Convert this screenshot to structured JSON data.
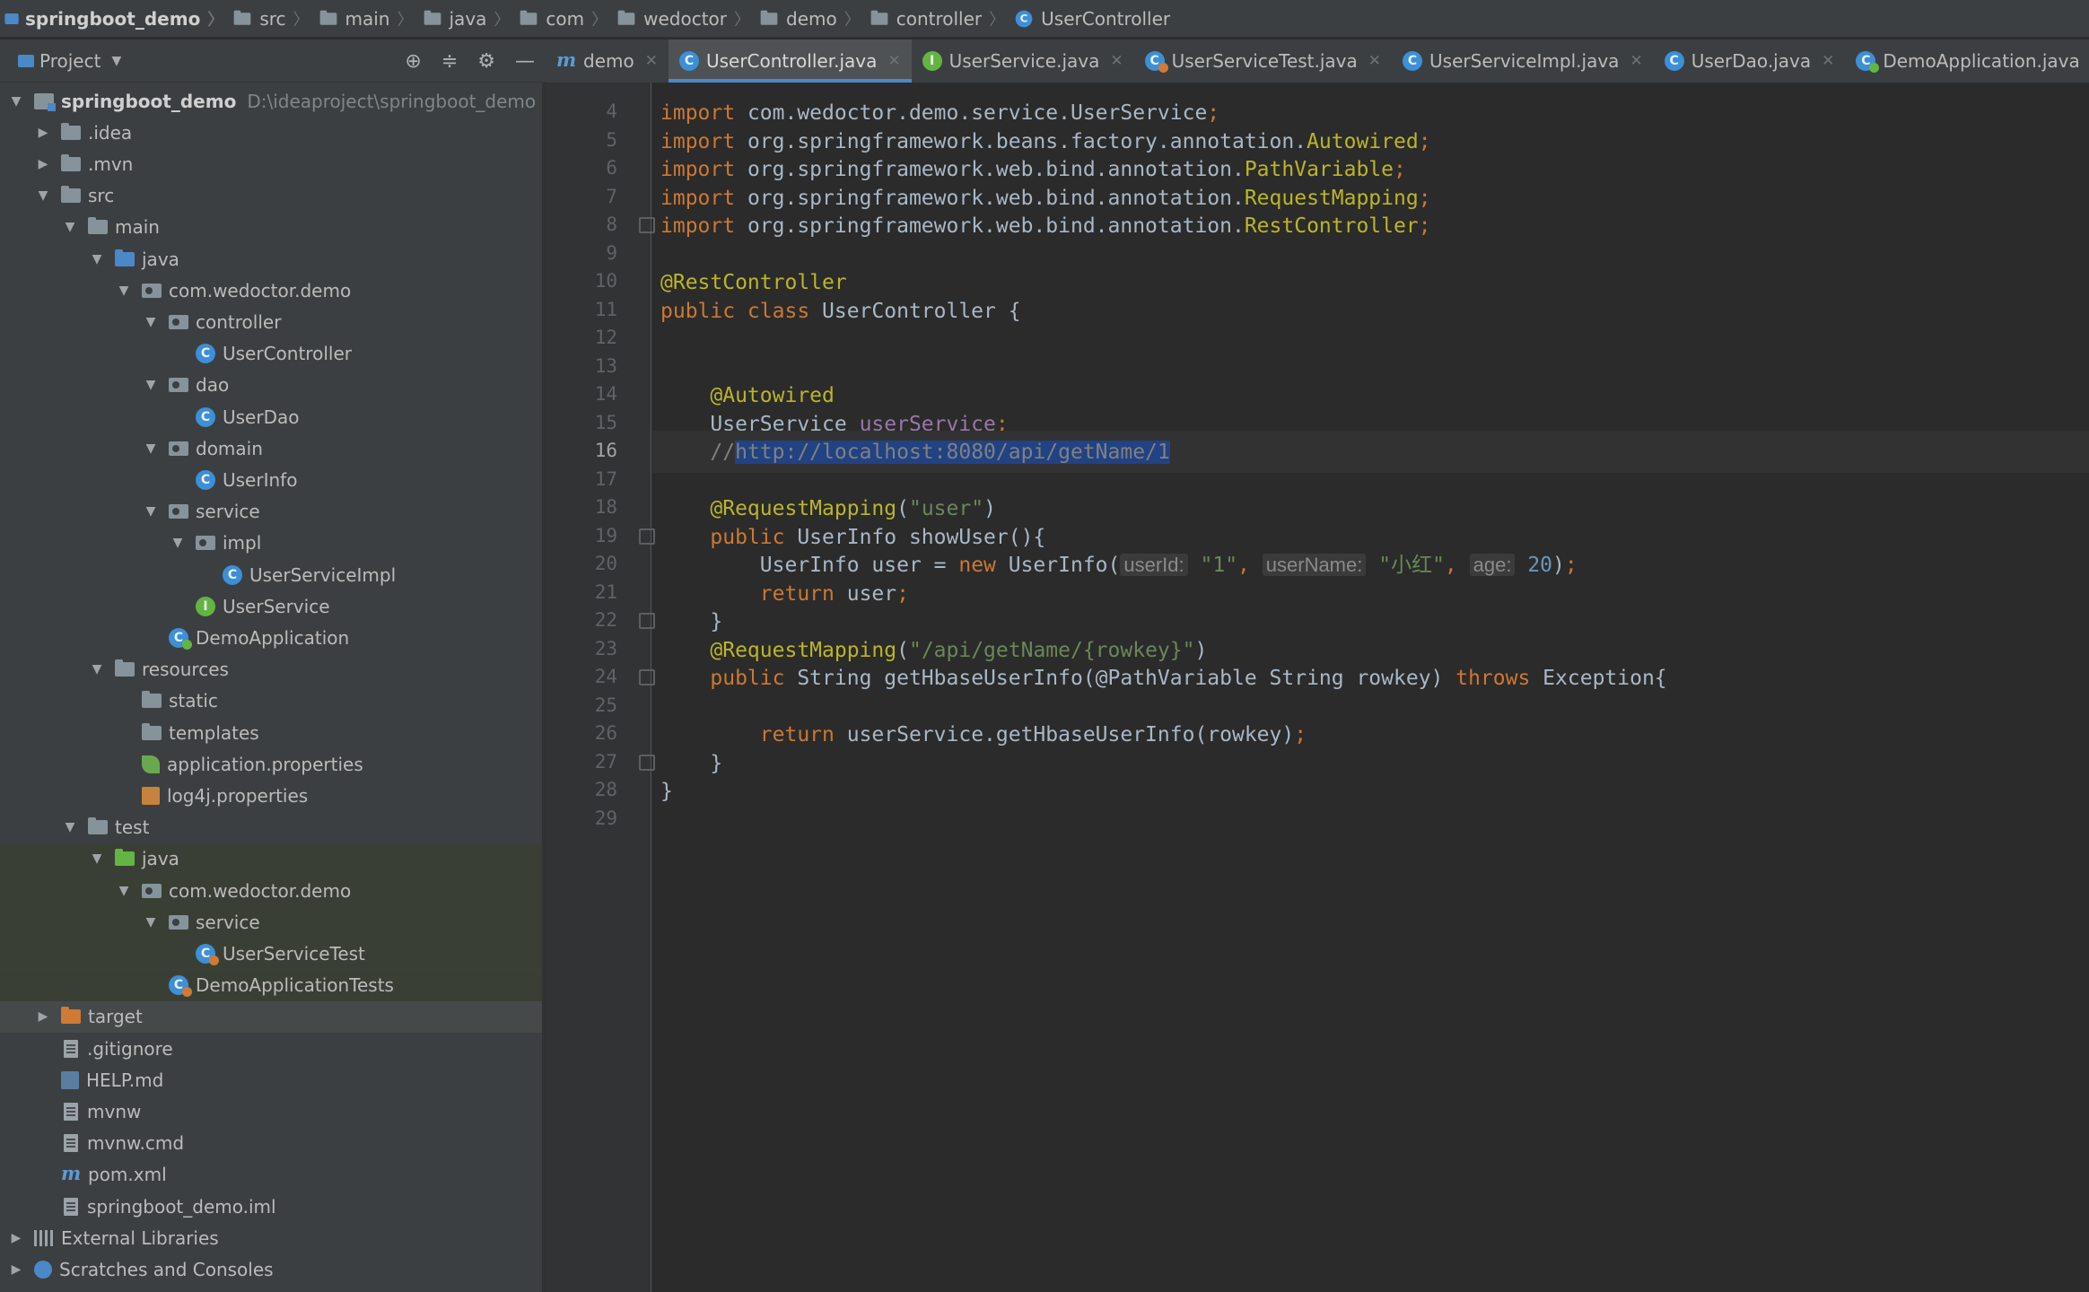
{
  "breadcrumb": [
    "springboot_demo",
    "src",
    "main",
    "java",
    "com",
    "wedoctor",
    "demo",
    "controller",
    "UserController"
  ],
  "project_panel": {
    "title": "Project",
    "toolbar_icons": [
      "locate-icon",
      "collapse-icon",
      "gear-icon",
      "minimize-icon"
    ],
    "tree": [
      {
        "label": "springboot_demo",
        "path": "D:\\ideaproject\\springboot_demo",
        "icon": "module-folder-icon",
        "depth": 0,
        "expanded": true
      },
      {
        "label": ".idea",
        "icon": "folder-icon",
        "depth": 1,
        "expanded": false
      },
      {
        "label": ".mvn",
        "icon": "folder-icon",
        "depth": 1,
        "expanded": false
      },
      {
        "label": "src",
        "icon": "folder-icon",
        "depth": 1,
        "expanded": true
      },
      {
        "label": "main",
        "icon": "folder-icon",
        "depth": 2,
        "expanded": true
      },
      {
        "label": "java",
        "icon": "source-folder-icon",
        "depth": 3,
        "expanded": true
      },
      {
        "label": "com.wedoctor.demo",
        "icon": "package-icon",
        "depth": 4,
        "expanded": true
      },
      {
        "label": "controller",
        "icon": "package-icon",
        "depth": 5,
        "expanded": true
      },
      {
        "label": "UserController",
        "icon": "class-icon",
        "depth": 6
      },
      {
        "label": "dao",
        "icon": "package-icon",
        "depth": 5,
        "expanded": true
      },
      {
        "label": "UserDao",
        "icon": "class-icon",
        "depth": 6
      },
      {
        "label": "domain",
        "icon": "package-icon",
        "depth": 5,
        "expanded": true
      },
      {
        "label": "UserInfo",
        "icon": "class-icon",
        "depth": 6
      },
      {
        "label": "service",
        "icon": "package-icon",
        "depth": 5,
        "expanded": true
      },
      {
        "label": "impl",
        "icon": "package-icon",
        "depth": 6,
        "expanded": true
      },
      {
        "label": "UserServiceImpl",
        "icon": "class-icon",
        "depth": 7
      },
      {
        "label": "UserService",
        "icon": "interface-icon",
        "depth": 6
      },
      {
        "label": "DemoApplication",
        "icon": "spring-app-class-icon",
        "depth": 5
      },
      {
        "label": "resources",
        "icon": "resources-folder-icon",
        "depth": 3,
        "expanded": true
      },
      {
        "label": "static",
        "icon": "folder-icon",
        "depth": 4
      },
      {
        "label": "templates",
        "icon": "folder-icon",
        "depth": 4
      },
      {
        "label": "application.properties",
        "icon": "spring-leaf-icon",
        "depth": 4
      },
      {
        "label": "log4j.properties",
        "icon": "properties-icon",
        "depth": 4
      },
      {
        "label": "test",
        "icon": "folder-icon",
        "depth": 2,
        "expanded": true
      },
      {
        "label": "java",
        "icon": "test-folder-icon",
        "depth": 3,
        "expanded": true,
        "highlight": "test"
      },
      {
        "label": "com.wedoctor.demo",
        "icon": "package-icon",
        "depth": 4,
        "expanded": true,
        "highlight": "test"
      },
      {
        "label": "service",
        "icon": "package-icon",
        "depth": 5,
        "expanded": true,
        "highlight": "test"
      },
      {
        "label": "UserServiceTest",
        "icon": "test-class-icon",
        "depth": 6,
        "highlight": "test"
      },
      {
        "label": "DemoApplicationTests",
        "icon": "test-class-icon",
        "depth": 5,
        "highlight": "test"
      },
      {
        "label": "target",
        "icon": "excluded-folder-icon",
        "depth": 1,
        "expanded": false,
        "highlight": "selected"
      },
      {
        "label": ".gitignore",
        "icon": "file-icon",
        "depth": 1
      },
      {
        "label": "HELP.md",
        "icon": "markdown-icon",
        "depth": 1
      },
      {
        "label": "mvnw",
        "icon": "file-icon",
        "depth": 1
      },
      {
        "label": "mvnw.cmd",
        "icon": "file-icon",
        "depth": 1
      },
      {
        "label": "pom.xml",
        "icon": "maven-icon",
        "depth": 1
      },
      {
        "label": "springboot_demo.iml",
        "icon": "file-icon",
        "depth": 1
      },
      {
        "label": "External Libraries",
        "icon": "libraries-icon",
        "depth": 0,
        "expanded": false
      },
      {
        "label": "Scratches and Consoles",
        "icon": "scratches-icon",
        "depth": 0,
        "expanded": false
      }
    ]
  },
  "tabs": [
    {
      "label": "demo",
      "icon": "maven-icon",
      "active": false
    },
    {
      "label": "UserController.java",
      "icon": "class-icon",
      "active": true
    },
    {
      "label": "UserService.java",
      "icon": "interface-icon",
      "active": false
    },
    {
      "label": "UserServiceTest.java",
      "icon": "test-class-icon",
      "active": false
    },
    {
      "label": "UserServiceImpl.java",
      "icon": "class-icon",
      "active": false
    },
    {
      "label": "UserDao.java",
      "icon": "class-icon",
      "active": false
    },
    {
      "label": "DemoApplication.java",
      "icon": "spring-app-class-icon",
      "active": false
    }
  ],
  "editor": {
    "current_line": 16,
    "lines": [
      {
        "n": 4,
        "tokens": [
          [
            "kw",
            "import"
          ],
          [
            "p",
            " com.wedoctor.demo.service.UserService"
          ],
          [
            "kw",
            ";"
          ]
        ]
      },
      {
        "n": 5,
        "tokens": [
          [
            "kw",
            "import"
          ],
          [
            "p",
            " org.springframework.beans.factory.annotation."
          ],
          [
            "ann",
            "Autowired"
          ],
          [
            "kw",
            ";"
          ]
        ]
      },
      {
        "n": 6,
        "tokens": [
          [
            "kw",
            "import"
          ],
          [
            "p",
            " org.springframework.web.bind.annotation."
          ],
          [
            "ann",
            "PathVariable"
          ],
          [
            "kw",
            ";"
          ]
        ]
      },
      {
        "n": 7,
        "tokens": [
          [
            "kw",
            "import"
          ],
          [
            "p",
            " org.springframework.web.bind.annotation."
          ],
          [
            "ann",
            "RequestMapping"
          ],
          [
            "kw",
            ";"
          ]
        ]
      },
      {
        "n": 8,
        "fold": true,
        "tokens": [
          [
            "kw",
            "import"
          ],
          [
            "p",
            " org.springframework.web.bind.annotation."
          ],
          [
            "ann",
            "RestController"
          ],
          [
            "kw",
            ";"
          ]
        ]
      },
      {
        "n": 9,
        "tokens": []
      },
      {
        "n": 10,
        "tokens": [
          [
            "ann",
            "@RestController"
          ]
        ]
      },
      {
        "n": 11,
        "tokens": [
          [
            "kw",
            "public class"
          ],
          [
            "p",
            " UserController {"
          ]
        ]
      },
      {
        "n": 12,
        "tokens": []
      },
      {
        "n": 13,
        "tokens": []
      },
      {
        "n": 14,
        "tokens": [
          [
            "p",
            "    "
          ],
          [
            "ann",
            "@Autowired"
          ]
        ]
      },
      {
        "n": 15,
        "tokens": [
          [
            "p",
            "    UserService "
          ],
          [
            "field",
            "userService"
          ],
          [
            "kw",
            ";"
          ]
        ]
      },
      {
        "n": 16,
        "tokens": [
          [
            "p",
            "    "
          ],
          [
            "cmt",
            "//"
          ],
          [
            "sel",
            "http://localhost:8080/api/getName/1"
          ]
        ]
      },
      {
        "n": 17,
        "tokens": []
      },
      {
        "n": 18,
        "tokens": [
          [
            "p",
            "    "
          ],
          [
            "ann",
            "@RequestMapping"
          ],
          [
            "p",
            "("
          ],
          [
            "str",
            "\"user\""
          ],
          [
            "p",
            ")"
          ]
        ]
      },
      {
        "n": 19,
        "fold": true,
        "tokens": [
          [
            "p",
            "    "
          ],
          [
            "kw",
            "public"
          ],
          [
            "p",
            " UserInfo showUser(){"
          ]
        ]
      },
      {
        "n": 20,
        "tokens": [
          [
            "p",
            "        UserInfo user = "
          ],
          [
            "kw",
            "new"
          ],
          [
            "p",
            " UserInfo("
          ],
          [
            "hint",
            "userId:"
          ],
          [
            "p",
            " "
          ],
          [
            "str",
            "\"1\""
          ],
          [
            "kw",
            ","
          ],
          [
            "p",
            " "
          ],
          [
            "hint",
            "userName:"
          ],
          [
            "p",
            " "
          ],
          [
            "str",
            "\"小红\""
          ],
          [
            "kw",
            ","
          ],
          [
            "p",
            " "
          ],
          [
            "hint",
            "age:"
          ],
          [
            "p",
            " "
          ],
          [
            "num",
            "20"
          ],
          [
            "p",
            ")"
          ],
          [
            "kw",
            ";"
          ]
        ]
      },
      {
        "n": 21,
        "tokens": [
          [
            "p",
            "        "
          ],
          [
            "kw",
            "return"
          ],
          [
            "p",
            " user"
          ],
          [
            "kw",
            ";"
          ]
        ]
      },
      {
        "n": 22,
        "fold": true,
        "tokens": [
          [
            "p",
            "    }"
          ]
        ]
      },
      {
        "n": 23,
        "tokens": [
          [
            "p",
            "    "
          ],
          [
            "ann",
            "@RequestMapping"
          ],
          [
            "p",
            "("
          ],
          [
            "str",
            "\"/api/getName/{rowkey}\""
          ],
          [
            "p",
            ")"
          ]
        ]
      },
      {
        "n": 24,
        "fold": true,
        "tokens": [
          [
            "p",
            "    "
          ],
          [
            "kw",
            "public"
          ],
          [
            "p",
            " String getHbaseUserInfo(@PathVariable String rowkey) "
          ],
          [
            "kw",
            "throws"
          ],
          [
            "p",
            " Exception{"
          ]
        ]
      },
      {
        "n": 25,
        "tokens": []
      },
      {
        "n": 26,
        "tokens": [
          [
            "p",
            "        "
          ],
          [
            "kw",
            "return"
          ],
          [
            "p",
            " userService.getHbaseUserInfo(rowkey)"
          ],
          [
            "kw",
            ";"
          ]
        ]
      },
      {
        "n": 27,
        "fold": true,
        "tokens": [
          [
            "p",
            "    }"
          ]
        ]
      },
      {
        "n": 28,
        "tokens": [
          [
            "p",
            "}"
          ]
        ]
      },
      {
        "n": 29,
        "tokens": []
      }
    ]
  },
  "colors": {
    "keyword": "#cc7832",
    "annotation": "#bbb529",
    "string": "#6a8759",
    "number": "#6897bb",
    "field": "#9876aa",
    "comment": "#808080",
    "selection": "#214283",
    "accent": "#4a88c7"
  }
}
